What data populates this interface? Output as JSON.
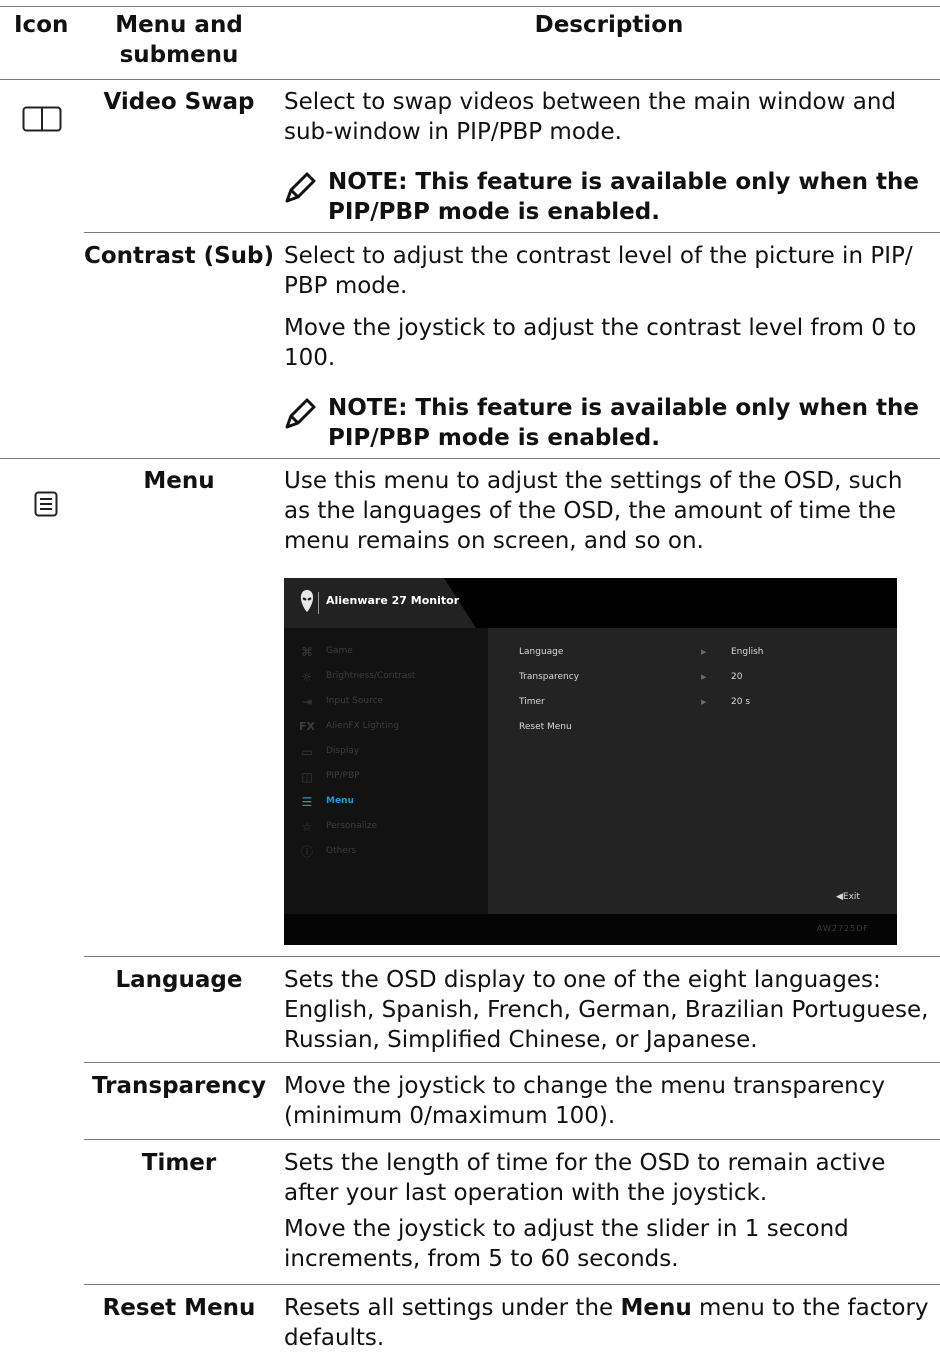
{
  "header": {
    "icon": "Icon",
    "menu_line1": "Menu and",
    "menu_line2": "submenu",
    "description": "Description"
  },
  "rows": {
    "video_swap": {
      "label": "Video Swap",
      "icon": "pip-split-icon",
      "desc": "Select to swap videos between the main window and sub-window in PIP/PBP mode.",
      "note_line1": "NOTE: This feature is available only when the",
      "note_line2": "PIP/PBP mode is enabled."
    },
    "contrast_sub": {
      "label": "Contrast (Sub)",
      "desc1": "Select to adjust the contrast level of the picture in PIP/ PBP mode.",
      "desc2": "Move the joystick to adjust the contrast level from 0 to 100.",
      "note_line1": "NOTE: This feature is available only when the",
      "note_line2": "PIP/PBP mode is enabled."
    },
    "menu": {
      "label": "Menu",
      "icon": "menu-list-icon",
      "desc": "Use this menu to adjust the settings of the OSD, such as the languages of the OSD, the amount of time the menu remains on screen, and so on."
    },
    "language": {
      "label": "Language",
      "desc": "Sets the OSD display to one of the eight languages: English, Spanish, French, German, Brazilian Portuguese, Russian, Simplified Chinese, or Japanese."
    },
    "transparency": {
      "label": "Transparency",
      "desc": "Move the joystick to change the menu transparency (minimum 0/maximum 100)."
    },
    "timer": {
      "label": "Timer",
      "desc1": "Sets the length of time for the OSD to remain active after your last operation with the joystick.",
      "desc2": "Move the joystick to adjust the slider in 1 second increments, from 5 to 60 seconds."
    },
    "reset_menu": {
      "label": "Reset Menu",
      "desc_pre": "Resets all settings under the ",
      "desc_bold": "Menu",
      "desc_post": " menu to the factory defaults."
    }
  },
  "osd": {
    "title": "Alienware 27 Monitor",
    "model": "AW2725DF",
    "exit": "◀Exit",
    "accent_color": "#1e9bd7",
    "menu_items": [
      {
        "label": "Game",
        "icon": "gamepad-icon",
        "active": false
      },
      {
        "label": "Brightness/Contrast",
        "icon": "sun-icon",
        "active": false
      },
      {
        "label": "Input Source",
        "icon": "input-arrow-icon",
        "active": false
      },
      {
        "label": "AlienFX Lighting",
        "icon": "fx-icon",
        "active": false
      },
      {
        "label": "Display",
        "icon": "monitor-icon",
        "active": false
      },
      {
        "label": "PIP/PBP",
        "icon": "pip-split-icon",
        "active": false
      },
      {
        "label": "Menu",
        "icon": "menu-list-icon",
        "active": true
      },
      {
        "label": "Personalize",
        "icon": "star-icon",
        "active": false
      },
      {
        "label": "Others",
        "icon": "info-icon",
        "active": false
      }
    ],
    "settings": [
      {
        "label": "Language",
        "value": "English"
      },
      {
        "label": "Transparency",
        "value": "20"
      },
      {
        "label": "Timer",
        "value": "20 s"
      },
      {
        "label": "Reset Menu",
        "value": ""
      }
    ]
  }
}
